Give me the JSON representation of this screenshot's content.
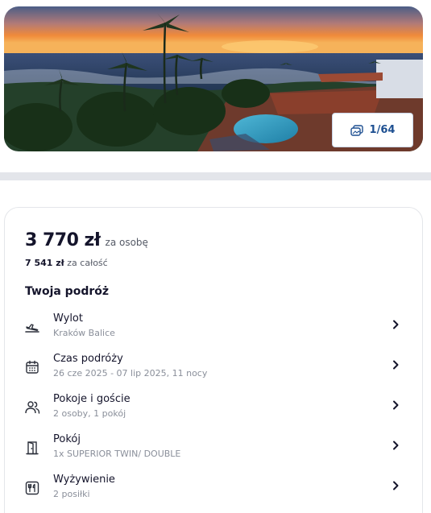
{
  "gallery": {
    "counter": "1/64",
    "icon": "gallery-icon"
  },
  "price": {
    "per_person": "3 770 zł",
    "per_person_suffix": "za osobę",
    "total": "7 541 zł",
    "total_suffix": "za całość"
  },
  "trip": {
    "title": "Twoja podróż",
    "items": [
      {
        "label": "Wylot",
        "value": "Kraków Balice",
        "icon": "plane-departure-icon"
      },
      {
        "label": "Czas podróży",
        "value": "26 cze 2025 - 07 lip 2025, 11 nocy",
        "icon": "calendar-icon"
      },
      {
        "label": "Pokoje i goście",
        "value": "2 osoby, 1 pokój",
        "icon": "guests-icon"
      },
      {
        "label": "Pokój",
        "value": "1x SUPERIOR TWIN/ DOUBLE",
        "icon": "door-icon"
      },
      {
        "label": "Wyżywienie",
        "value": "2 posiłki",
        "icon": "cutlery-icon"
      }
    ]
  },
  "colors": {
    "accent": "#1d4f91",
    "text": "#14142b",
    "muted": "#8a8f9a",
    "band": "#e3e5ea"
  }
}
